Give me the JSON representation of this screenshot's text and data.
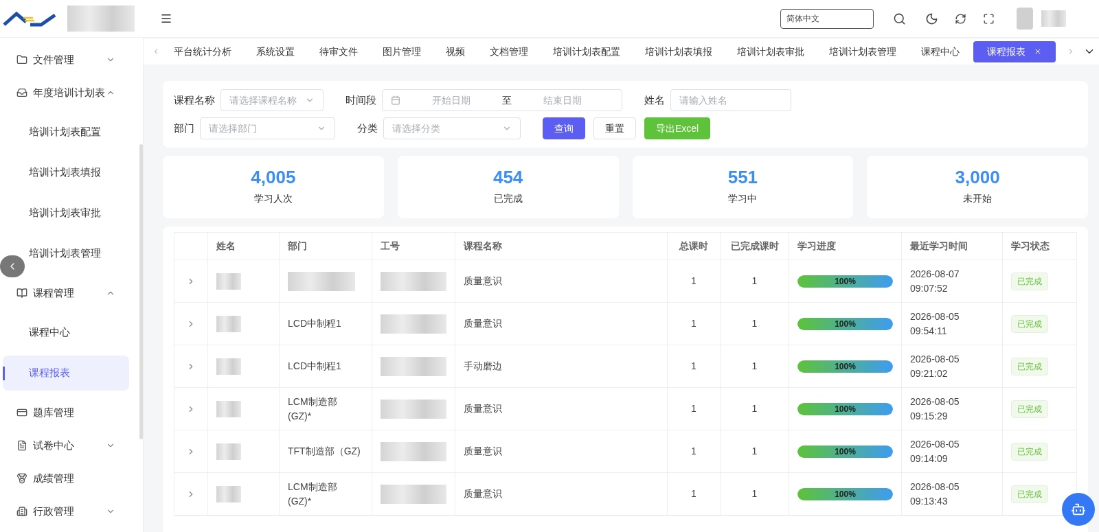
{
  "header": {
    "language": {
      "value": "简体中文"
    }
  },
  "sidebar": {
    "items": [
      {
        "label": "文件管理",
        "expanded": false,
        "selected": false
      },
      {
        "label": "年度培训计划表",
        "expanded": true,
        "selected": false,
        "children": [
          {
            "label": "培训计划表配置",
            "selected": false
          },
          {
            "label": "培训计划表填报",
            "selected": false
          },
          {
            "label": "培训计划表审批",
            "selected": false
          },
          {
            "label": "培训计划表管理",
            "selected": false
          }
        ]
      },
      {
        "label": "课程管理",
        "expanded": true,
        "selected": false,
        "children": [
          {
            "label": "课程中心",
            "selected": false
          },
          {
            "label": "课程报表",
            "selected": true
          }
        ]
      },
      {
        "label": "题库管理",
        "selected": false
      },
      {
        "label": "试卷中心",
        "expanded": false,
        "selected": false
      },
      {
        "label": "成绩管理",
        "selected": false
      },
      {
        "label": "行政管理",
        "expanded": false,
        "selected": false
      }
    ]
  },
  "tabs": [
    {
      "label": "平台统计分析",
      "selected": false
    },
    {
      "label": "系统设置",
      "selected": false
    },
    {
      "label": "待审文件",
      "selected": false
    },
    {
      "label": "图片管理",
      "selected": false
    },
    {
      "label": "视频",
      "selected": false
    },
    {
      "label": "文档管理",
      "selected": false
    },
    {
      "label": "培训计划表配置",
      "selected": false
    },
    {
      "label": "培训计划表填报",
      "selected": false
    },
    {
      "label": "培训计划表审批",
      "selected": false
    },
    {
      "label": "培训计划表管理",
      "selected": false
    },
    {
      "label": "课程中心",
      "selected": false
    },
    {
      "label": "课程报表",
      "selected": true
    }
  ],
  "filters": {
    "rows": [
      [
        {
          "kind": "select",
          "label": "课程名称",
          "placeholder": "请选择课程名称"
        },
        {
          "kind": "daterange",
          "label": "时间段",
          "start_placeholder": "开始日期",
          "separator": "至",
          "end_placeholder": "结束日期"
        },
        {
          "kind": "input",
          "label": "姓名",
          "placeholder": "请输入姓名"
        }
      ],
      [
        {
          "kind": "select",
          "label": "部门",
          "placeholder": "请选择部门"
        },
        {
          "kind": "select",
          "label": "分类",
          "placeholder": "请选择分类"
        }
      ]
    ],
    "buttons": [
      {
        "label": "查询",
        "kind": "primary"
      },
      {
        "label": "重置",
        "kind": "default"
      },
      {
        "label": "导出Excel",
        "kind": "success"
      }
    ]
  },
  "stats": [
    {
      "value": "4,005",
      "label": "学习人次"
    },
    {
      "value": "454",
      "label": "已完成"
    },
    {
      "value": "551",
      "label": "学习中"
    },
    {
      "value": "3,000",
      "label": "未开始"
    }
  ],
  "table": {
    "columns": [
      "姓名",
      "部门",
      "工号",
      "课程名称",
      "总课时",
      "已完成课时",
      "学习进度",
      "最近学习时间",
      "学习状态"
    ],
    "rows": [
      {
        "course": "质量意识",
        "total": "1",
        "done": "1",
        "level": 1,
        "progress": "100%",
        "date": "2026-08-07",
        "time": "09:07:52",
        "status": "已完成"
      },
      {
        "department": "LCD中制程1",
        "course": "质量意识",
        "total": "1",
        "done": "1",
        "level": 1,
        "progress": "100%",
        "date": "2026-08-05",
        "time": "09:54:11",
        "status": "已完成"
      },
      {
        "department": "LCD中制程1",
        "course": "手动磨边",
        "total": "1",
        "done": "1",
        "level": 1,
        "progress": "100%",
        "date": "2026-08-05",
        "time": "09:21:02",
        "status": "已完成"
      },
      {
        "department": "LCM制造部\n(GZ)*",
        "course": "质量意识",
        "total": "1",
        "done": "1",
        "level": 1,
        "progress": "100%",
        "date": "2026-08-05",
        "time": "09:15:29",
        "status": "已完成"
      },
      {
        "department": "TFT制造部（GZ)",
        "course": "质量意识",
        "total": "1",
        "done": "1",
        "level": 1,
        "progress": "100%",
        "date": "2026-08-05",
        "time": "09:14:09",
        "status": "已完成"
      },
      {
        "department": "LCM制造部\n(GZ)*",
        "course": "质量意识",
        "total": "1",
        "done": "1",
        "level": 1,
        "progress": "100%",
        "date": "2026-08-05",
        "time": "09:13:43",
        "status": "已完成"
      }
    ]
  }
}
